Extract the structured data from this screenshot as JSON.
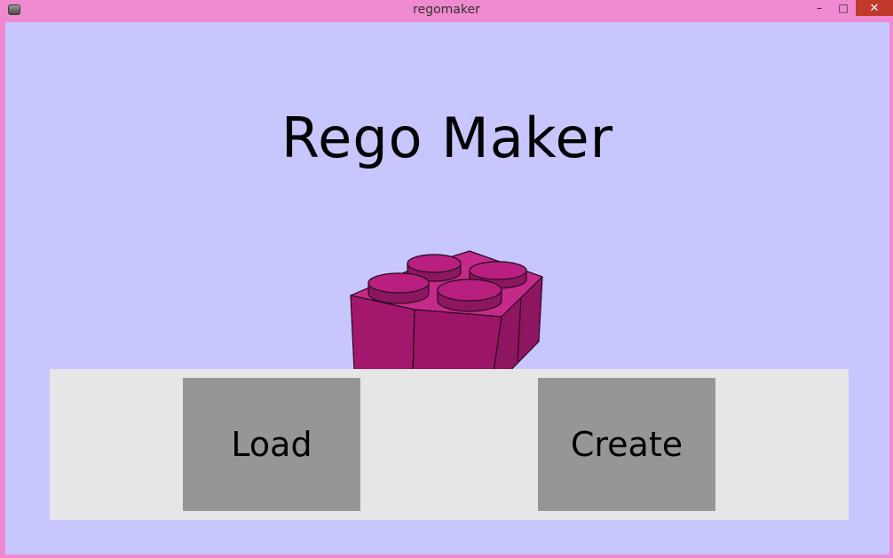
{
  "window": {
    "title": "regomaker",
    "controls": {
      "minimize": "–",
      "maximize": "□",
      "close": "✕"
    },
    "icon": "app-icon"
  },
  "main": {
    "heading": "Rego Maker",
    "image": "lego-brick-icon",
    "brick_color": "#a4176e",
    "background_color": "#c8c6fe",
    "panel_color": "#e6e6e6",
    "button_color": "#969696"
  },
  "actions": {
    "load_label": "Load",
    "create_label": "Create"
  }
}
